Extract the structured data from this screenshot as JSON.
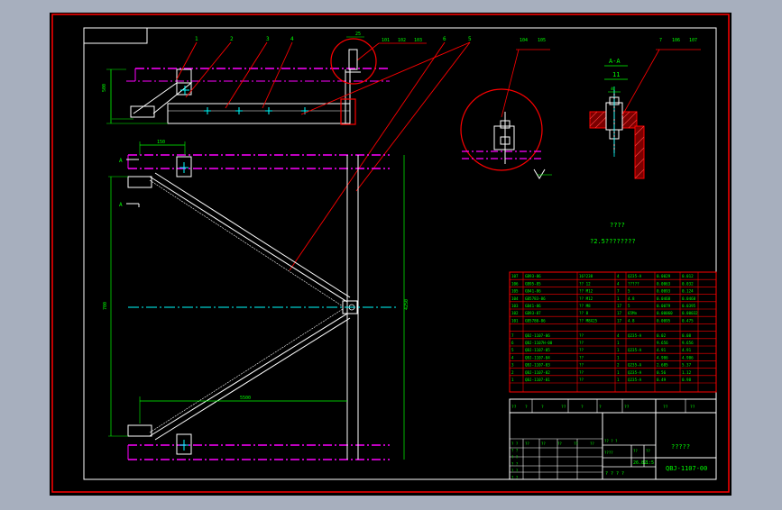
{
  "colors": {
    "outer_bg": "#a7afbe",
    "canvas_bg": "#000000",
    "frame": "#ff0000",
    "line": "#ffffff",
    "leader": "#ff0000",
    "dim": "#00ff00",
    "center": "#00ffff",
    "phantom": "#ff00ff",
    "text": "#00ff00",
    "title_text": "#ffffff"
  },
  "balloons": {
    "main_top": [
      "1",
      "2",
      "3",
      "4",
      "6",
      "5"
    ],
    "main_top_right": [
      "101",
      "102",
      "103"
    ],
    "detail_top": [
      "104",
      "105"
    ],
    "section_top": [
      "7",
      "106",
      "107"
    ]
  },
  "section": {
    "label": "A-A",
    "sub": "11"
  },
  "dims": {
    "d25": "25",
    "d150": "150",
    "d700": "700",
    "d5500": "5500",
    "dvert": "500",
    "dright": "4250",
    "dsmall": "40"
  },
  "section_marks": {
    "upper": "A",
    "lower": "A"
  },
  "notes": {
    "heading": "????",
    "line1": "?2.5????????"
  },
  "bom": {
    "rows": [
      {
        "no": "107",
        "code": "GB93-86",
        "name": "16?238",
        "qty": "4",
        "mat": "Q235-A",
        "w1": "0.0029",
        "w2": "0.012"
      },
      {
        "no": "106",
        "code": "GB95-85",
        "name": "?? 12",
        "qty": "4",
        "mat": "?????",
        "w1": "0.0063",
        "w2": "0.032"
      },
      {
        "no": "105",
        "code": "GB41-86",
        "name": "?? M12",
        "qty": "7",
        "mat": "5",
        "w1": "0.0093",
        "w2": "0.124"
      },
      {
        "no": "104",
        "code": "GB5783-86",
        "name": "?? M12",
        "qty": "1",
        "mat": "4.8",
        "w1": "0.0468",
        "w2": "0.0468"
      },
      {
        "no": "103",
        "code": "GB41-86",
        "name": "?? M8",
        "qty": "17",
        "mat": "5",
        "w1": "0.0079",
        "w2": "0.0395"
      },
      {
        "no": "102",
        "code": "GB93-87",
        "name": "?? 8",
        "qty": "17",
        "mat": "65Mn",
        "w1": "0.00060",
        "w2": "0.00032"
      },
      {
        "no": "101",
        "code": "GB5780-86",
        "name": "?? M8X25",
        "qty": "17",
        "mat": "4.8",
        "w1": "0.0095",
        "w2": "0.475"
      },
      {
        "no": "",
        "code": "",
        "name": "",
        "qty": "",
        "mat": "",
        "w1": "",
        "w2": ""
      },
      {
        "no": "7",
        "code": "QBJ-1107-06",
        "name": "??",
        "qty": "4",
        "mat": "Q235-A",
        "w1": "0.02",
        "w2": "0.08"
      },
      {
        "no": "6",
        "code": "QBJ-1107H-00",
        "name": "??",
        "qty": "1",
        "mat": "",
        "w1": "9.656",
        "w2": "9.656"
      },
      {
        "no": "5",
        "code": "QBJ-1107-05",
        "name": "??",
        "qty": "1",
        "mat": "Q235-A",
        "w1": "4.91",
        "w2": "4.91"
      },
      {
        "no": "4",
        "code": "QBJ-1107-04",
        "name": "??",
        "qty": "1",
        "mat": "",
        "w1": "4.906",
        "w2": "4.906"
      },
      {
        "no": "3",
        "code": "QBJ-1107-03",
        "name": "??",
        "qty": "2",
        "mat": "Q235-A",
        "w1": "2.685",
        "w2": "5.37"
      },
      {
        "no": "2",
        "code": "QBJ-1107-02",
        "name": "??",
        "qty": "1",
        "mat": "Q235-A",
        "w1": "0.56",
        "w2": "1.12"
      },
      {
        "no": "1",
        "code": "QBJ-1107-01",
        "name": "??",
        "qty": "1",
        "mat": "Q235-A",
        "w1": "0.49",
        "w2": "0.98"
      }
    ],
    "header": [
      "??",
      "?",
      "?",
      "??",
      "?",
      "?",
      "??",
      "??",
      "??"
    ]
  },
  "title_block": {
    "drawing_title": "?????",
    "drawing_no": "QBJ-1107-00",
    "scale_row": [
      "?? ? ?",
      "????",
      "??",
      "??"
    ],
    "mass": "26.82",
    "scale": "1:5",
    "sheet": "? ? ? ?",
    "left_cells": [
      "? ?",
      "? ?",
      "? ?",
      "? ?",
      "? ?",
      "? ?"
    ],
    "sig_labels": [
      "??",
      "??",
      "??",
      "??",
      "??"
    ]
  }
}
